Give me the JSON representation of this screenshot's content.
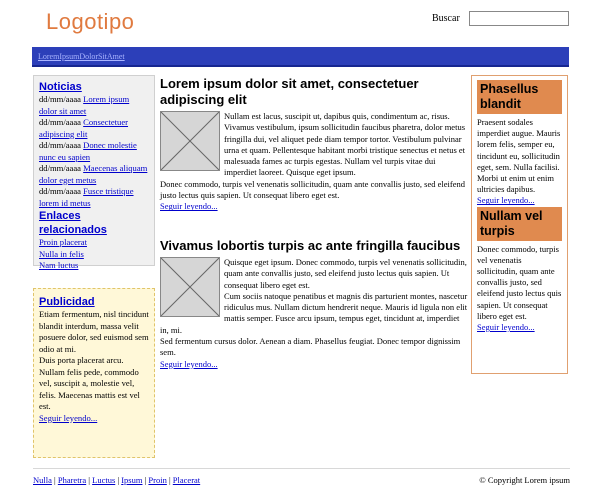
{
  "header": {
    "logo": "Logotipo",
    "search_label": "Buscar",
    "search_value": ""
  },
  "nav": {
    "links_text": "LoremIpsumDolorSitAmet"
  },
  "noticias": {
    "title": "Noticias",
    "items": [
      {
        "date": "dd/mm/aaaa",
        "link": "Lorem ipsum dolor sit amet"
      },
      {
        "date": "dd/mm/aaaa",
        "link": "Consectetuer adipiscing elit"
      },
      {
        "date": "dd/mm/aaaa",
        "link": "Donec molestie nunc eu sapien"
      },
      {
        "date": "dd/mm/aaaa",
        "link": "Maecenas aliquam dolor eget metus"
      },
      {
        "date": "dd/mm/aaaa",
        "link": "Fusce tristique lorem id metus"
      }
    ],
    "related_title": "Enlaces relacionados",
    "related": [
      "Proin placerat",
      "Nulla in felis",
      "Nam luctus"
    ]
  },
  "publicidad": {
    "title": "Publicidad",
    "text1": "Etiam fermentum, nisl tincidunt blandit interdum, massa velit posuere dolor, sed euismod sem odio at mi.",
    "text2": "Duis porta placerat arcu. Nullam felis pede, commodo vel, suscipit a, molestie vel, felis. Maecenas mattis est vel est.",
    "more": "Seguir leyendo..."
  },
  "articles": [
    {
      "title": "Lorem ipsum dolor sit amet, consectetuer adipiscing elit",
      "p1": "Nullam est lacus, suscipit ut, dapibus quis, condimentum ac, risus. Vivamus vestibulum, ipsum sollicitudin faucibus pharetra, dolor metus fringilla dui, vel aliquet pede diam tempor tortor. Vestibulum pulvinar urna et quam. Pellentesque habitant morbi tristique senectus et netus et malesuada fames ac turpis egestas. Nullam vel turpis vitae dui imperdiet laoreet. Quisque eget ipsum.",
      "p2": "Donec commodo, turpis vel venenatis sollicitudin, quam ante convallis justo, sed eleifend justo lectus quis sapien. Ut consequat libero eget est.",
      "more": "Seguir leyendo..."
    },
    {
      "title": "Vivamus lobortis turpis ac ante fringilla faucibus",
      "p1": "Quisque eget ipsum. Donec commodo, turpis vel venenatis sollicitudin, quam ante convallis justo, sed eleifend justo lectus quis sapien. Ut consequat libero eget est.",
      "p2": "Cum sociis natoque penatibus et magnis dis parturient montes, nascetur ridiculus mus. Nullam dictum hendrerit neque. Mauris id ligula non elit mattis semper. Fusce arcu ipsum, tempus eget, tincidunt at, imperdiet in, mi.",
      "p3": "Sed fermentum cursus dolor. Aenean a diam. Phasellus feugiat. Donec tempor dignissim sem.",
      "more": "Seguir leyendo..."
    }
  ],
  "right": {
    "box1_title": "Phasellus blandit",
    "box1_text": "Praesent sodales imperdiet augue. Mauris lorem felis, semper eu, tincidunt eu, sollicitudin eget, sem. Nulla facilisi. Morbi ut enim ut enim ultricies dapibus.",
    "box1_more": "Seguir leyendo...",
    "box2_title": "Nullam vel turpis",
    "box2_text": "Donec commodo, turpis vel venenatis sollicitudin, quam ante convallis justo, sed eleifend justo lectus quis sapien. Ut consequat libero eget est.",
    "box2_more": "Seguir leyendo..."
  },
  "footer": {
    "links": [
      "Nulla",
      "Pharetra",
      "Luctus",
      "Ipsum",
      "Proin",
      "Placerat"
    ],
    "separator": " | ",
    "copyright": "© Copyright Lorem ipsum"
  },
  "colors": {
    "logo": "#e07a3f",
    "navbar": "#2c3fb9",
    "link": "#0000cc",
    "right_head": "#e08a4f",
    "publicidad_bg": "#fff8d8"
  }
}
